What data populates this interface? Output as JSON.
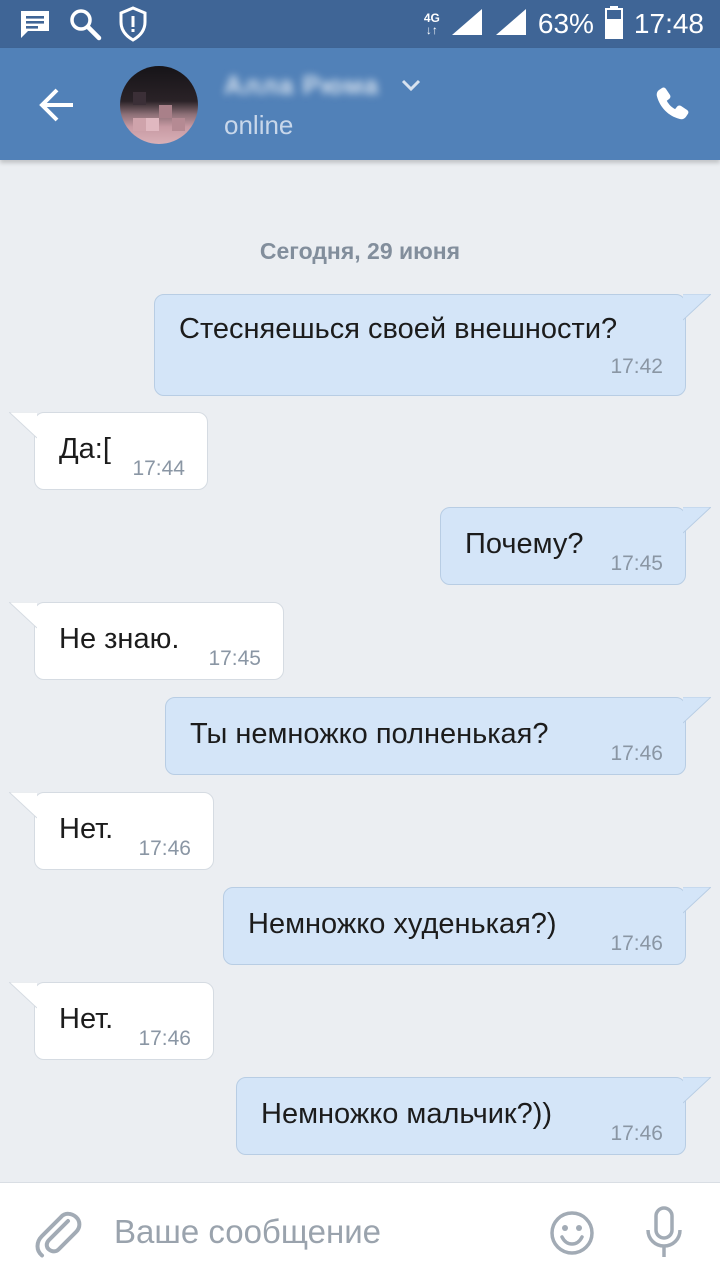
{
  "status_bar": {
    "network_type": "4G",
    "battery_percent": "63%",
    "time": "17:48",
    "icons": [
      "message-notification-icon",
      "search-notification-icon",
      "shield-alert-icon",
      "signal-icon",
      "battery-icon"
    ]
  },
  "header": {
    "contact_name": "Алла Рюма",
    "status": "online",
    "icons": [
      "back-arrow-icon",
      "chevron-down-icon",
      "phone-icon"
    ]
  },
  "chat": {
    "date_separator": "Сегодня, 29 июня",
    "messages": [
      {
        "direction": "out",
        "text": "Стесняешься своей внешности?",
        "time": "17:42"
      },
      {
        "direction": "in",
        "text": "Да:[",
        "time": "17:44"
      },
      {
        "direction": "out",
        "text": "Почему?",
        "time": "17:45"
      },
      {
        "direction": "in",
        "text": "Не знаю.",
        "time": "17:45"
      },
      {
        "direction": "out",
        "text": "Ты немножко полненькая?",
        "time": "17:46"
      },
      {
        "direction": "in",
        "text": "Нет.",
        "time": "17:46"
      },
      {
        "direction": "out",
        "text": "Немножко худенькая?)",
        "time": "17:46"
      },
      {
        "direction": "in",
        "text": "Нет.",
        "time": "17:46"
      },
      {
        "direction": "out",
        "text": "Немножко мальчик?))",
        "time": "17:46"
      }
    ]
  },
  "composer": {
    "placeholder": "Ваше сообщение",
    "value": "",
    "icons": [
      "paperclip-icon",
      "smiley-icon",
      "microphone-icon"
    ]
  },
  "colors": {
    "status_bar": "#3f6596",
    "header": "#5181b8",
    "background": "#ebeef2",
    "outgoing_bubble": "#d4e5f8",
    "incoming_bubble": "#ffffff"
  }
}
